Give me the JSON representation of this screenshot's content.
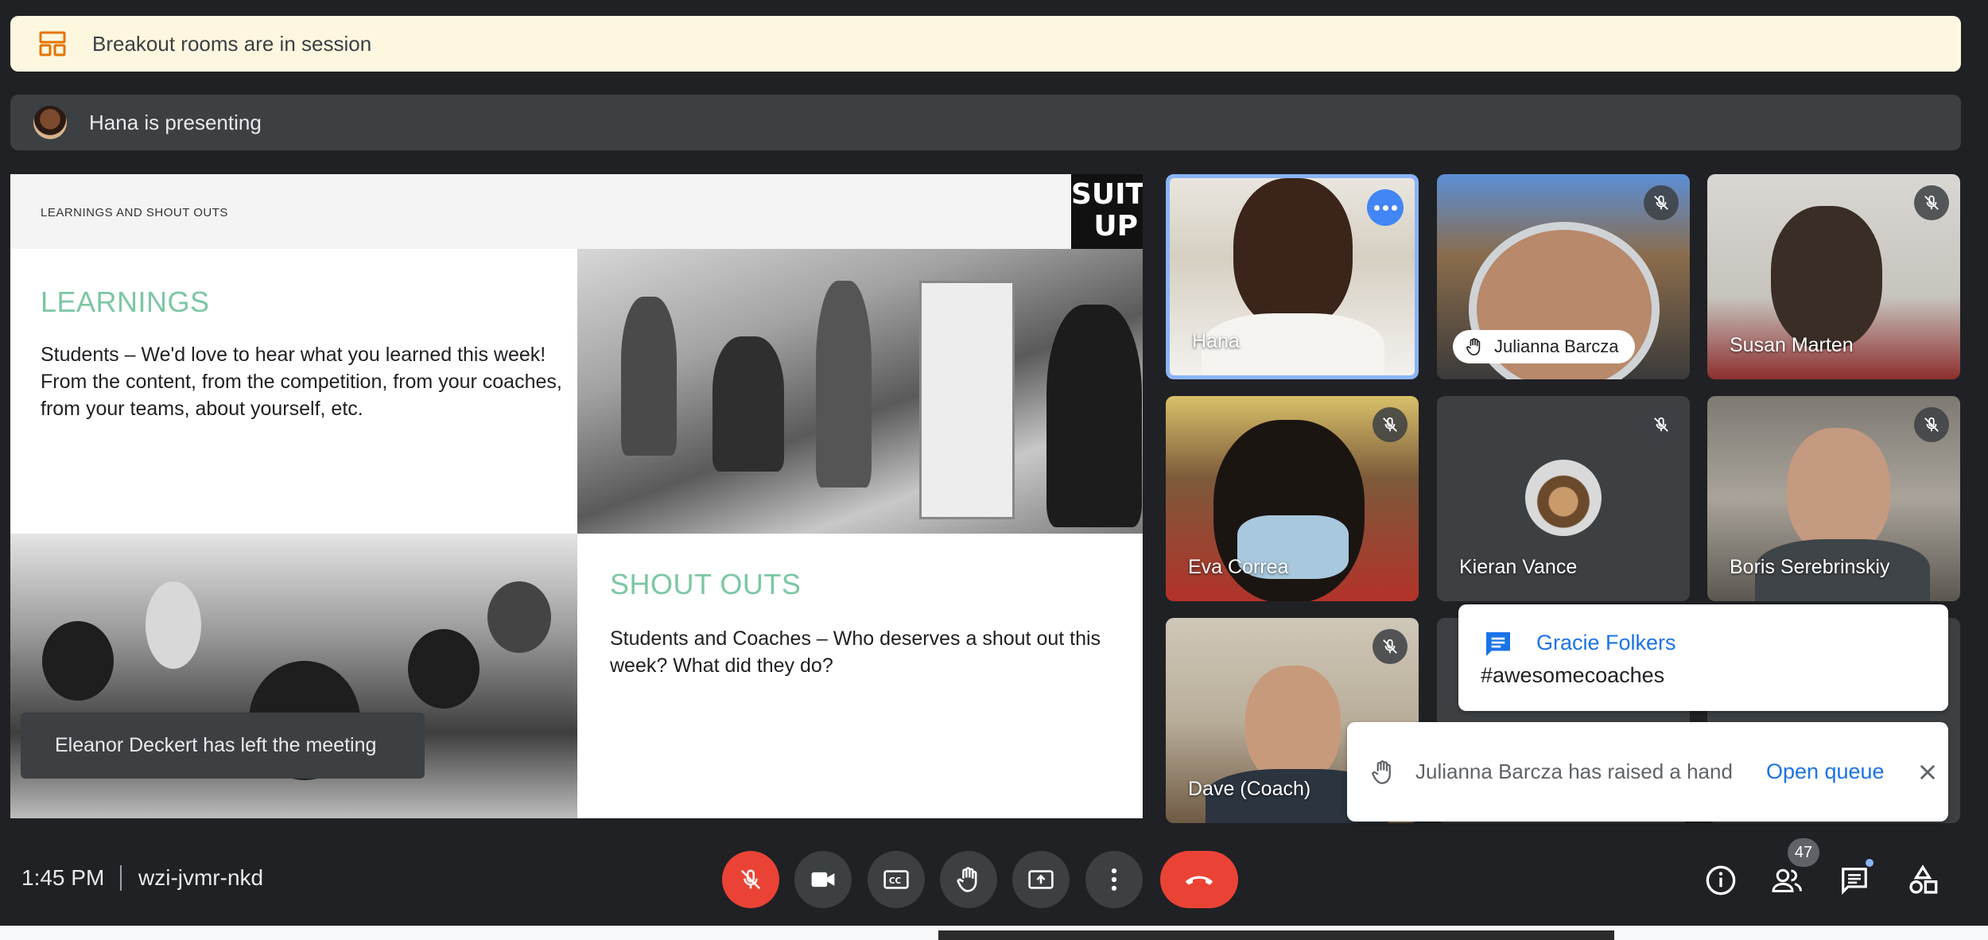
{
  "banners": {
    "breakout": "Breakout rooms are in session",
    "presenting": "Hana is presenting"
  },
  "slide": {
    "header_label": "LEARNINGS AND SHOUT OUTS",
    "logo_line1": "SUIT",
    "logo_line2": "UP",
    "learnings_title": "LEARNINGS",
    "learnings_body": "Students – We'd love to hear what you learned this week! From the content, from the competition, from your coaches, from your teams, about yourself, etc.",
    "shoutouts_title": "SHOUT OUTS",
    "shoutouts_body": "Students and Coaches – Who deserves a shout out this week? What did they do?"
  },
  "toasts": {
    "left_meeting": "Eleanor Deckert has left the meeting",
    "chat_sender": "Gracie Folkers",
    "chat_message": "#awesomecoaches",
    "hand_raised": "Julianna Barcza has raised a hand",
    "open_queue": "Open queue"
  },
  "participants": [
    {
      "name": "Hana"
    },
    {
      "name": "Julianna Barcza"
    },
    {
      "name": "Susan Marten"
    },
    {
      "name": "Eva Correa"
    },
    {
      "name": "Kieran Vance"
    },
    {
      "name": "Boris Serebrinskiy"
    },
    {
      "name": "Dave (Coach)"
    }
  ],
  "meeting": {
    "time": "1:45 PM",
    "code": "wzi-jvmr-nkd",
    "people_count": "47"
  },
  "colors": {
    "background": "#202124",
    "accent_blue": "#1a73e8",
    "danger_red": "#ea4335",
    "slide_green": "#7cc7a2",
    "breakout_banner": "#fef7e0"
  }
}
